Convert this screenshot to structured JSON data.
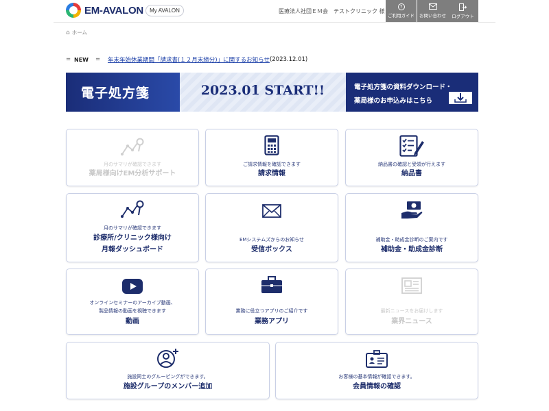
{
  "header": {
    "logo_text": "EM-AVALON",
    "my_avalon": "My AVALON",
    "clinic": "医療法人社団ＥＭ会　テストクリニック 様",
    "buttons": [
      {
        "label": "ご利用ガイド",
        "icon": "help-circle-icon"
      },
      {
        "label": "お問い合わせ",
        "icon": "mail-icon"
      },
      {
        "label": "ログアウト",
        "icon": "logout-icon"
      }
    ]
  },
  "breadcrumb": {
    "home": "ホーム"
  },
  "news": {
    "tag": "NEW",
    "text": "年末年始休業期間「請求書(１２月末締分)」に関するお知らせ",
    "date": "(2023.12.01)"
  },
  "banner": {
    "left": "電子処方箋",
    "mid": "2023.01 START!!",
    "right_line1": "電子処方箋の資料ダウンロード・",
    "right_line2": "薬局様のお申込みはこちら"
  },
  "cards": [
    {
      "desc": "月のサマリが確認できます",
      "title": "薬局様向けEM分析サポート",
      "icon": "analytics-icon",
      "enabled": false
    },
    {
      "desc": "ご請求情報を確認できます",
      "title": "請求情報",
      "icon": "calculator-icon",
      "enabled": true
    },
    {
      "desc": "納品書の確認と受領が行えます",
      "title": "納品書",
      "icon": "checklist-icon",
      "enabled": true
    },
    {
      "desc": "月のサマリが確認できます",
      "title": "診療所/クリニック様向け",
      "title2": "月報ダッシュボード",
      "icon": "analytics-icon",
      "enabled": true
    },
    {
      "desc": "EMシステムズからのお知らせ",
      "title": "受信ボックス",
      "icon": "envelope-icon",
      "enabled": true
    },
    {
      "desc": "補助金・助成金診断のご案内です",
      "title": "補助金・助成金診断",
      "icon": "money-hand-icon",
      "enabled": true
    },
    {
      "desc": "オンラインセミナーのアーカイブ動画、",
      "desc2": "製品情報の動画を視聴できます",
      "title": "動画",
      "icon": "youtube-icon",
      "enabled": true
    },
    {
      "desc": "業務に役立つアプリのご紹介です",
      "title": "業務アプリ",
      "icon": "briefcase-icon",
      "enabled": true
    },
    {
      "desc": "最新ニュースをお届けします",
      "title": "業界ニュース",
      "icon": "newspaper-icon",
      "enabled": false
    },
    {
      "desc": "施設同士のグルーピングができます。",
      "title": "施設グループのメンバー追加",
      "icon": "add-user-icon",
      "enabled": true
    },
    {
      "desc": "お客様の基本情報が確認できます。",
      "title": "会員情報の確認",
      "icon": "id-card-icon",
      "enabled": true
    }
  ],
  "colors": {
    "primary": "#1d2d6b",
    "banner_bg": "#1a2d78",
    "header_btn": "#7e7e7e",
    "youtube_red": "#1d2d6b"
  }
}
